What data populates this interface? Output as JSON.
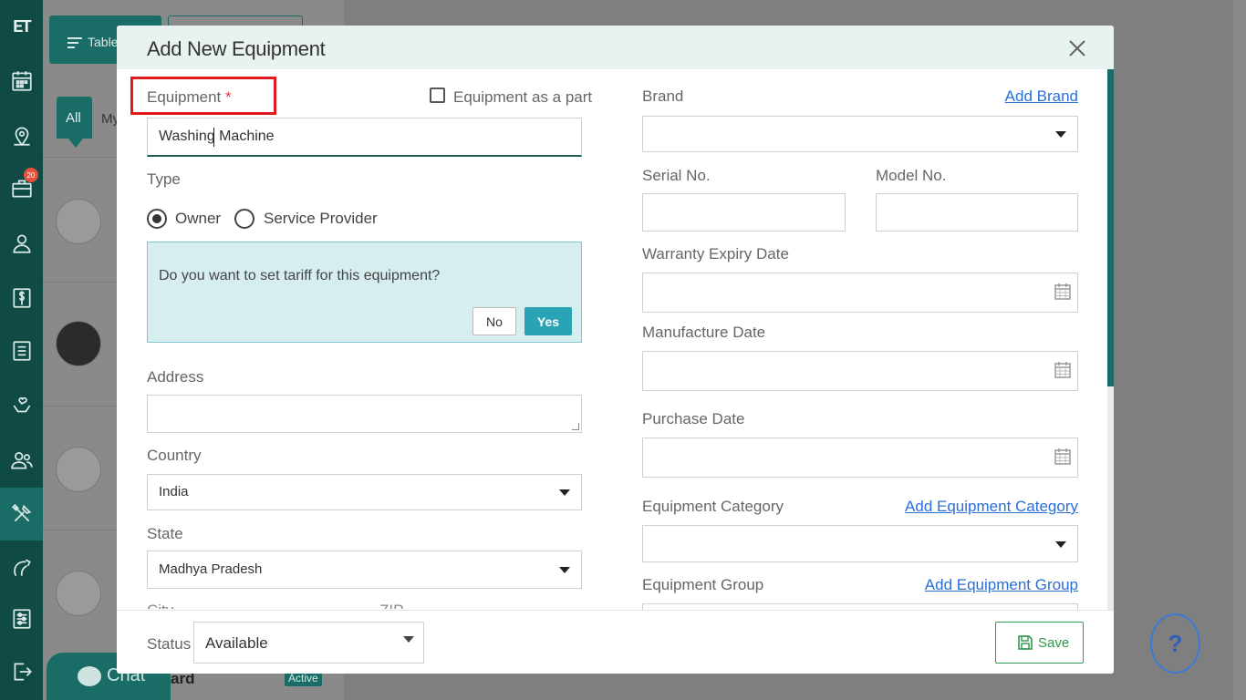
{
  "sidebar": {
    "logo": "ET",
    "badge_count": "20",
    "items": [
      "calendar-icon",
      "map-pin-icon",
      "briefcase-icon",
      "user-icon",
      "dollar-icon",
      "list-icon",
      "heart-hands-icon",
      "users-icon",
      "tools-icon",
      "contract-icon",
      "settings-sliders-icon",
      "logout-icon"
    ]
  },
  "background": {
    "table_button": "Table",
    "tab_all": "All",
    "tab_my": "My",
    "chat_label": "Chat",
    "list_name_partial": "ard",
    "active_badge": "Active",
    "help_label": "?"
  },
  "modal": {
    "title": "Add New Equipment",
    "equipment_label": "Equipment",
    "required_mark": "*",
    "equipment_as_part_label": "Equipment as a part",
    "equipment_value": "Washing Machine",
    "type_label": "Type",
    "type_owner": "Owner",
    "type_service_provider": "Service Provider",
    "tariff_question": "Do you want to set tariff for this equipment?",
    "tariff_no": "No",
    "tariff_yes": "Yes",
    "address_label": "Address",
    "address_value": "",
    "country_label": "Country",
    "country_value": "India",
    "state_label": "State",
    "state_value": "Madhya Pradesh",
    "city_label": "City",
    "zip_label": "ZIP",
    "brand_label": "Brand",
    "add_brand_link": "Add Brand",
    "brand_value": "",
    "serial_label": "Serial No.",
    "model_label": "Model No.",
    "warranty_label": "Warranty Expiry Date",
    "manufacture_label": "Manufacture Date",
    "purchase_label": "Purchase Date",
    "category_label": "Equipment Category",
    "add_category_link": "Add Equipment Category",
    "group_label": "Equipment Group",
    "add_group_link": "Add Equipment Group",
    "status_label": "Status",
    "status_value": "Available",
    "save_label": "Save"
  },
  "colors": {
    "sidebar_bg": "#0f4a45",
    "accent": "#1a6d66",
    "highlight": "#e0191c",
    "tariff_bg": "#d7eef1",
    "yes_button": "#2aa3b5",
    "save_green": "#2e9a4c",
    "link_blue": "#2a6fd6"
  }
}
